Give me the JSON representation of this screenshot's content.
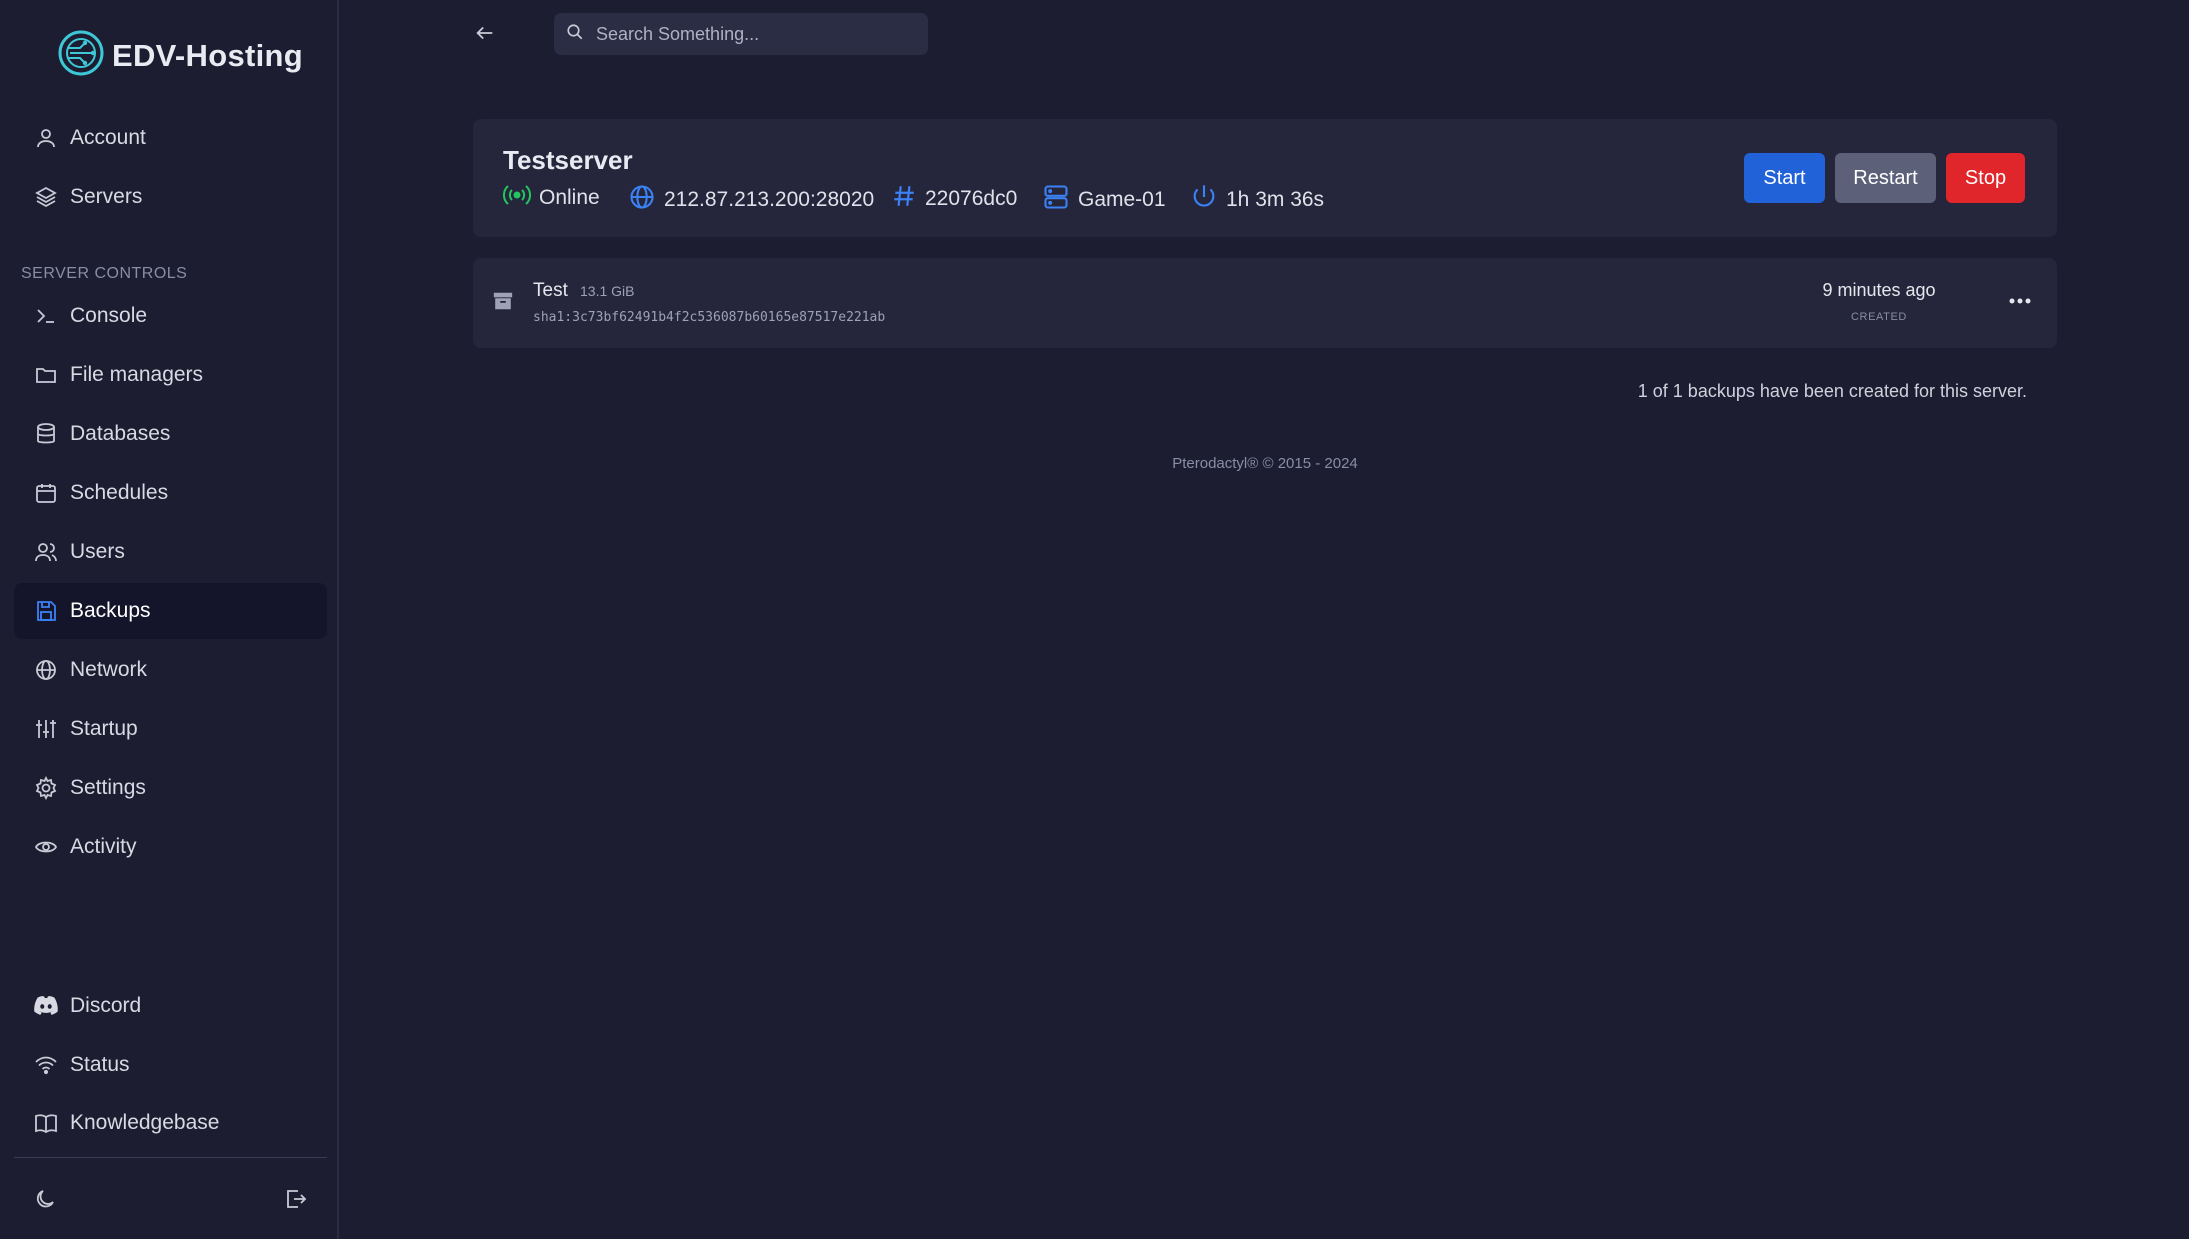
{
  "brand": {
    "name": "EDV-Hosting"
  },
  "sidebar": {
    "top_items": [
      {
        "label": "Account",
        "icon": "user-icon"
      },
      {
        "label": "Servers",
        "icon": "layers-icon"
      }
    ],
    "section_label": "SERVER CONTROLS",
    "control_items": [
      {
        "label": "Console",
        "icon": "terminal-icon"
      },
      {
        "label": "File managers",
        "icon": "folder-icon"
      },
      {
        "label": "Databases",
        "icon": "database-icon"
      },
      {
        "label": "Schedules",
        "icon": "calendar-icon"
      },
      {
        "label": "Users",
        "icon": "users-icon"
      },
      {
        "label": "Backups",
        "icon": "save-icon",
        "active": true
      },
      {
        "label": "Network",
        "icon": "globe-icon"
      },
      {
        "label": "Startup",
        "icon": "sliders-icon"
      },
      {
        "label": "Settings",
        "icon": "gear-icon"
      },
      {
        "label": "Activity",
        "icon": "eye-icon"
      }
    ],
    "bottom_items": [
      {
        "label": "Discord",
        "icon": "discord-icon"
      },
      {
        "label": "Status",
        "icon": "wifi-icon"
      },
      {
        "label": "Knowledgebase",
        "icon": "book-icon"
      }
    ]
  },
  "search": {
    "placeholder": "Search Something..."
  },
  "server": {
    "name": "Testserver",
    "status": "Online",
    "address": "212.87.213.200:28020",
    "id": "22076dc0",
    "node": "Game-01",
    "uptime": "1h 3m 36s",
    "buttons": {
      "start": "Start",
      "restart": "Restart",
      "stop": "Stop"
    }
  },
  "backups": [
    {
      "name": "Test",
      "size": "13.1 GiB",
      "hash": "sha1:3c73bf62491b4f2c536087b60165e87517e221ab",
      "time": "9 minutes ago",
      "time_label": "CREATED"
    }
  ],
  "backups_count_text": "1 of 1 backups have been created for this server.",
  "footer": "Pterodactyl® © 2015 - 2024",
  "colors": {
    "background": "#1c1d30",
    "card": "#25263b",
    "accent_blue": "#2262d9",
    "stop_red": "#e0262b",
    "online_green": "#22c55e"
  }
}
